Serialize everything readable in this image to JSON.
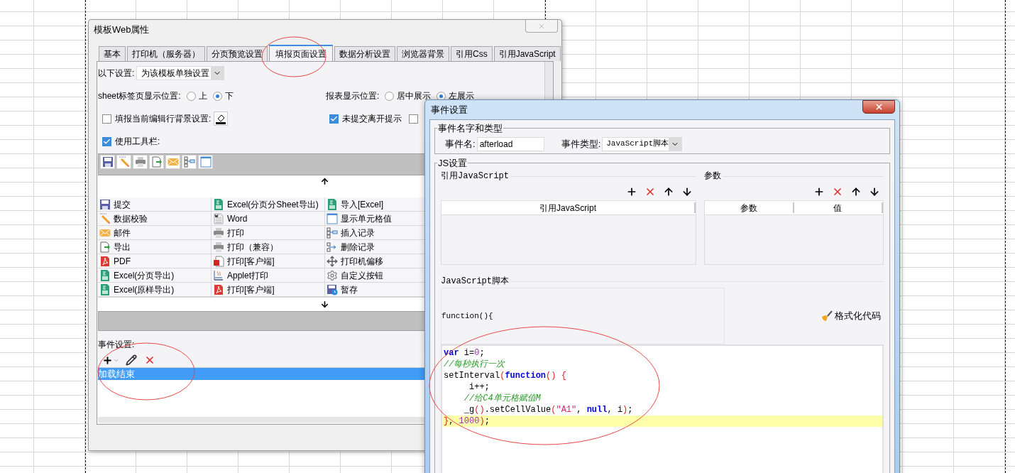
{
  "web_window": {
    "title": "模板Web属性",
    "tabs": [
      {
        "label": "基本",
        "selected": false
      },
      {
        "label": "打印机（服务器）",
        "selected": false
      },
      {
        "label": "分页预览设置",
        "selected": false
      },
      {
        "label": "填报页面设置",
        "selected": true
      },
      {
        "label": "数据分析设置",
        "selected": false
      },
      {
        "label": "浏览器背景",
        "selected": false
      },
      {
        "label": "引用Css",
        "selected": false
      },
      {
        "label": "引用JavaScript",
        "selected": false
      }
    ],
    "scope": {
      "label": "以下设置:",
      "value": "为该模板单独设置"
    },
    "sheet_tab_position": {
      "label": "sheet标签页显示位置:",
      "options": [
        {
          "label": "上",
          "selected": false
        },
        {
          "label": "下",
          "selected": true
        }
      ]
    },
    "report_position": {
      "label": "报表显示位置:",
      "options": [
        {
          "label": "居中展示",
          "selected": false
        },
        {
          "label": "左展示",
          "selected": true
        }
      ]
    },
    "row_background": {
      "label": "填报当前编辑行背景设置:",
      "checked": false
    },
    "leave_prompt": {
      "label": "未提交离开提示",
      "checked": true
    },
    "direct_option": {
      "checked": false
    },
    "use_toolbar": {
      "label": "使用工具栏:",
      "checked": true
    },
    "toolbar_buttons": [
      {
        "kind": "save"
      },
      {
        "kind": "pencil"
      },
      {
        "kind": "print"
      },
      {
        "kind": "export"
      },
      {
        "kind": "mail"
      },
      {
        "kind": "insert"
      },
      {
        "kind": "window"
      }
    ],
    "toolbar_options": [
      {
        "label": "提交",
        "kind": "save"
      },
      {
        "label": "Excel(分页分Sheet导出)",
        "kind": "excel"
      },
      {
        "label": "导入[Excel]",
        "kind": "excel"
      },
      {
        "label": "数据校验",
        "kind": "pencil"
      },
      {
        "label": "Word",
        "kind": "word"
      },
      {
        "label": "显示单元格值",
        "kind": "window"
      },
      {
        "label": "邮件",
        "kind": "mail"
      },
      {
        "label": "打印",
        "kind": "print"
      },
      {
        "label": "插入记录",
        "kind": "insert"
      },
      {
        "label": "导出",
        "kind": "export"
      },
      {
        "label": "打印（兼容）",
        "kind": "print"
      },
      {
        "label": "删除记录",
        "kind": "delete"
      },
      {
        "label": "PDF",
        "kind": "pdf"
      },
      {
        "label": "打印[客户端]",
        "kind": "flash"
      },
      {
        "label": "打印机偏移",
        "kind": "move"
      },
      {
        "label": "Excel(分页导出)",
        "kind": "excel"
      },
      {
        "label": "Applet打印",
        "kind": "applet"
      },
      {
        "label": "自定义按钮",
        "kind": "gear"
      },
      {
        "label": "Excel(原样导出)",
        "kind": "excel"
      },
      {
        "label": "打印[客户端]",
        "kind": "pdf"
      },
      {
        "label": "暂存",
        "kind": "saveclock"
      }
    ],
    "events_label": "事件设置:",
    "events": [
      {
        "label": "加载结束",
        "selected": true
      }
    ]
  },
  "event_window": {
    "title": "事件设置",
    "name_group": {
      "legend": "事件名字和类型",
      "name_label": "事件名:",
      "name_value": "afterload",
      "type_label": "事件类型:",
      "type_value": "JavaScript脚本"
    },
    "js_group": {
      "legend": "JS设置",
      "references": {
        "title": "引用JavaScript",
        "columns": [
          "引用JavaScript"
        ]
      },
      "parameters": {
        "title": "参数",
        "columns": [
          "参数",
          "值"
        ]
      },
      "script_title": "JavaScript脚本",
      "signature": "function(){",
      "format_button": "格式化代码",
      "code": [
        {
          "highlighted": false,
          "tokens": [
            {
              "kind": "keyword",
              "text": "var"
            },
            {
              "kind": "plain",
              "text": " i="
            },
            {
              "kind": "number",
              "text": "0"
            },
            {
              "kind": "plain",
              "text": ";"
            }
          ]
        },
        {
          "highlighted": false,
          "tokens": [
            {
              "kind": "comment",
              "text": "//每秒执行一次"
            }
          ]
        },
        {
          "highlighted": false,
          "tokens": [
            {
              "kind": "plain",
              "text": "setInterval"
            },
            {
              "kind": "paren",
              "text": "("
            },
            {
              "kind": "keyword",
              "text": "function"
            },
            {
              "kind": "paren",
              "text": "() {"
            }
          ]
        },
        {
          "highlighted": false,
          "tokens": [
            {
              "kind": "plain",
              "text": "     i++;"
            }
          ]
        },
        {
          "highlighted": false,
          "tokens": [
            {
              "kind": "comment",
              "text": "    //给C4单元格赋值M"
            }
          ]
        },
        {
          "highlighted": false,
          "tokens": [
            {
              "kind": "plain",
              "text": "    _g"
            },
            {
              "kind": "paren",
              "text": "()"
            },
            {
              "kind": "plain",
              "text": ".setCellValue"
            },
            {
              "kind": "paren",
              "text": "("
            },
            {
              "kind": "string",
              "text": "\"A1\""
            },
            {
              "kind": "plain",
              "text": ", "
            },
            {
              "kind": "keyword",
              "text": "null"
            },
            {
              "kind": "plain",
              "text": ", i"
            },
            {
              "kind": "paren",
              "text": ")"
            },
            {
              "kind": "plain",
              "text": ";"
            }
          ]
        },
        {
          "highlighted": true,
          "tokens": [
            {
              "kind": "paren",
              "text": "}"
            },
            {
              "kind": "plain",
              "text": ", "
            },
            {
              "kind": "number",
              "text": "1000"
            },
            {
              "kind": "paren",
              "text": ")"
            },
            {
              "kind": "plain",
              "text": ";"
            }
          ]
        }
      ]
    }
  },
  "annotations": [
    {
      "kind": "ellipse"
    },
    {
      "kind": "ellipse"
    },
    {
      "kind": "ellipse"
    }
  ]
}
